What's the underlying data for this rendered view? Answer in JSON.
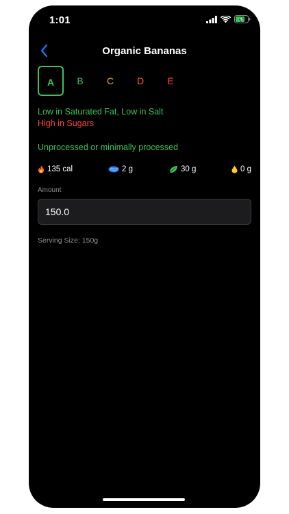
{
  "status_bar": {
    "time": "1:01"
  },
  "nav": {
    "title": "Organic Bananas"
  },
  "nutri_grades": [
    {
      "label": "A",
      "color": "#3cc45a",
      "selected": true
    },
    {
      "label": "B",
      "color": "#3cc45a",
      "selected": false
    },
    {
      "label": "C",
      "color": "#f0a030",
      "selected": false
    },
    {
      "label": "D",
      "color": "#ff5a3c",
      "selected": false
    },
    {
      "label": "E",
      "color": "#ff453a",
      "selected": false
    }
  ],
  "descriptions": {
    "low": "Low in Saturated Fat, Low in Salt",
    "high": "High in Sugars",
    "processing": "Unprocessed or minimally processed"
  },
  "colors": {
    "accent_green": "#3cc45a",
    "warning_red": "#ff453a",
    "back_blue": "#0a84ff"
  },
  "macros": [
    {
      "icon": "flame-icon",
      "value": "135 cal"
    },
    {
      "icon": "protein-icon",
      "value": "2 g"
    },
    {
      "icon": "carbs-leaf-icon",
      "value": "30 g"
    },
    {
      "icon": "fat-drop-icon",
      "value": "0 g"
    }
  ],
  "amount": {
    "label": "Amount",
    "value": "150.0"
  },
  "serving_size": "Serving Size: 150g"
}
